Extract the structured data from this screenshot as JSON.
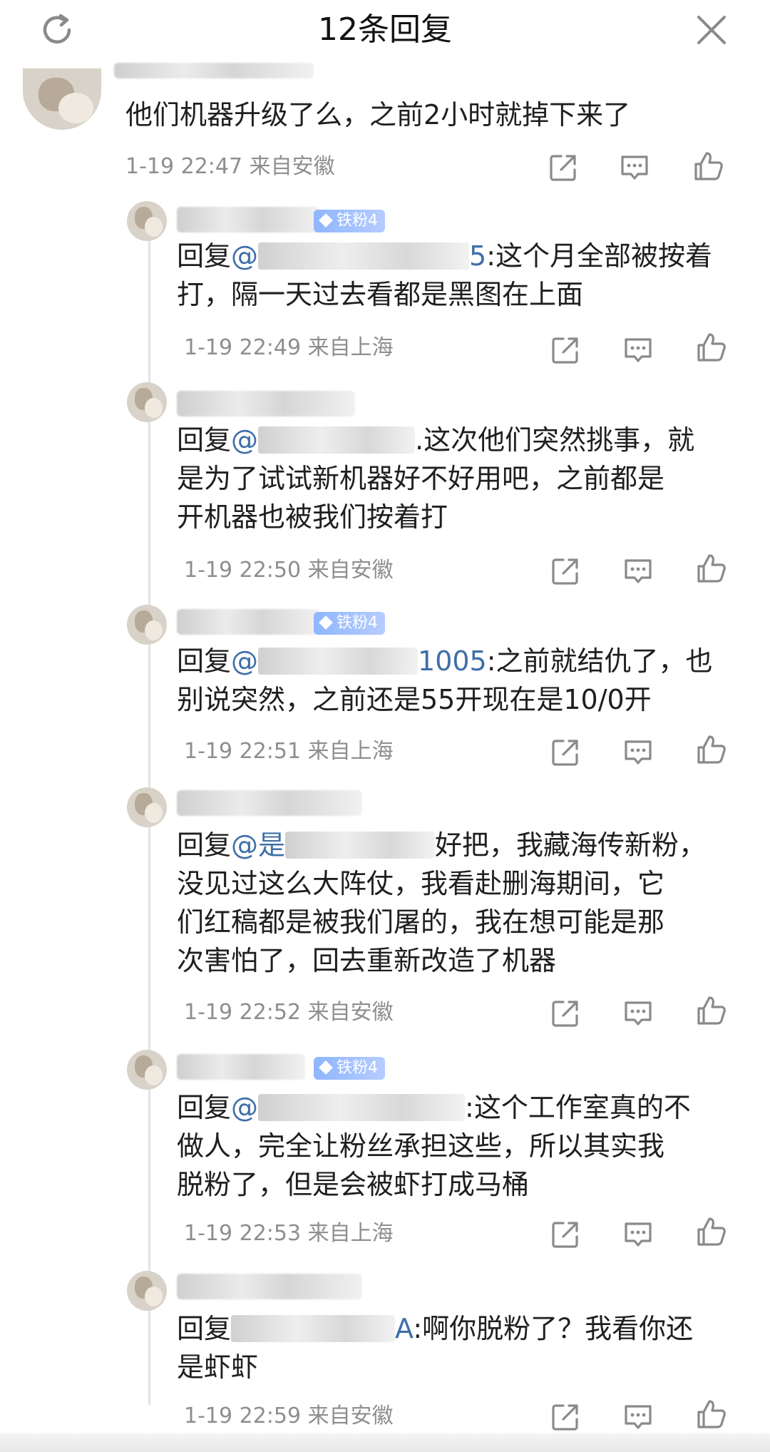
{
  "header": {
    "title": "12条回复"
  },
  "comments": [
    {
      "body": "他们机器升级了么，之前2小时就掉下来了",
      "time": "1-19 22:47",
      "location": "来自安徽"
    },
    {
      "badge": "铁粉4",
      "reply_prefix": "回复",
      "mention": "@",
      "mention_tail": "5",
      "body_first": ":这个月全部被按着",
      "body_rest": "打，隔一天过去看都是黑图在上面",
      "time": "1-19 22:49",
      "location": "来自上海"
    },
    {
      "reply_prefix": "回复",
      "mention": "@",
      "body_first": ".这次他们突然挑事，就",
      "body_rest": "是为了试试新机器好不好用吧，之前都是\n开机器也被我们按着打",
      "time": "1-19 22:50",
      "location": "来自安徽"
    },
    {
      "badge": "铁粉4",
      "reply_prefix": "回复",
      "mention": "@",
      "mention_tail": "1005",
      "body_first": ":之前就结仇了，也",
      "body_rest": "别说突然，之前还是55开现在是10/0开",
      "time": "1-19 22:51",
      "location": "来自上海"
    },
    {
      "reply_prefix": "回复",
      "mention": "@",
      "mention_tail": "是",
      "body_first": "好把，我藏海传新粉，",
      "body_rest": "没见过这么大阵仗，我看赴删海期间，它\n们红稿都是被我们屠的，我在想可能是那\n次害怕了，回去重新改造了机器",
      "time": "1-19 22:52",
      "location": "来自安徽"
    },
    {
      "badge": "铁粉4",
      "reply_prefix": "回复",
      "mention": "@",
      "body_first": ":这个工作室真的不",
      "body_rest": "做人，完全让粉丝承担这些，所以其实我\n脱粉了，但是会被虾打成马桶",
      "time": "1-19 22:53",
      "location": "来自上海"
    },
    {
      "reply_prefix": "回复",
      "mention_tail": "A",
      "body_first": ":啊你脱粉了？我看你还",
      "body_rest": "是虾虾",
      "time": "1-19 22:59",
      "location": "来自安徽"
    }
  ],
  "icons": [
    "refresh-icon",
    "close-icon",
    "share-icon",
    "comment-icon",
    "like-icon"
  ],
  "colors": {
    "mention": "#3e6fa8",
    "meta": "#8e8e8e",
    "badge": "#8fb6ff"
  }
}
